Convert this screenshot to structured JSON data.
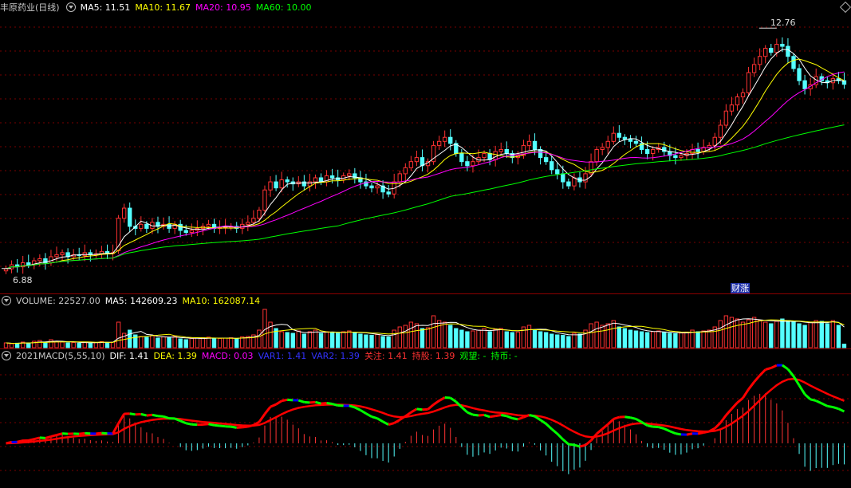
{
  "colors": {
    "bg": "#000000",
    "up": "#ff3232",
    "down": "#54ffff",
    "grid": "#7a0000",
    "sep": "#8b0000",
    "ma5": "#ffffff",
    "ma10": "#ffff00",
    "ma20": "#ff00ff",
    "ma60": "#00ff00",
    "vma5": "#ffffff",
    "vma10": "#ffff00",
    "dif_up": "#ff0000",
    "dif_down": "#00ff00",
    "dif_flat": "#0000ff",
    "dea": "#ff0000",
    "macd_pos": "#ff3232",
    "macd_neg": "#54ffff",
    "var1": "#3333ff",
    "var2": "#3333ff",
    "guanzhu": "#ff3232",
    "chigu": "#ff3232",
    "guanwang": "#00ff00",
    "chibi": "#00ff00"
  },
  "price_panel": {
    "title": "丰原药业(日线)",
    "ma5": "MA5: 11.51",
    "ma10": "MA10: 11.67",
    "ma20": "MA20: 10.95",
    "ma60": "MA60: 10.00",
    "high_label": "12.76",
    "low_label": "6.88",
    "event_label": "财涨"
  },
  "volume_panel": {
    "title": "VOLUME: 22527.00",
    "ma5": "MA5: 142609.23",
    "ma10": "MA10: 162087.14"
  },
  "macd_panel": {
    "title": "2021MACD(5,55,10)",
    "dif": "DIF: 1.41",
    "dea": "DEA: 1.39",
    "macd": "MACD: 0.03",
    "var1": "VAR1: 1.41",
    "var2": "VAR2: 1.39",
    "guanzhu": "关注: 1.41",
    "chigu": "持股: 1.39",
    "guanwang": "观望: -",
    "chibi": "持币: -"
  },
  "chart_data": {
    "type": "candlestick",
    "count": 150,
    "price_range": [
      6.5,
      13.2
    ],
    "high": 12.76,
    "low": 6.88,
    "candles_count_note": "",
    "closes": [
      6.95,
      7.05,
      7.0,
      7.1,
      7.05,
      7.15,
      7.2,
      7.1,
      7.25,
      7.3,
      7.35,
      7.25,
      7.3,
      7.28,
      7.35,
      7.3,
      7.32,
      7.38,
      7.33,
      7.35,
      8.2,
      8.45,
      8.0,
      7.95,
      8.05,
      7.95,
      8.1,
      8.0,
      8.05,
      7.95,
      8.05,
      7.9,
      7.85,
      7.9,
      7.95,
      8.0,
      8.05,
      7.95,
      7.98,
      7.98,
      8.0,
      7.95,
      8.05,
      8.1,
      8.2,
      8.4,
      8.9,
      9.1,
      8.95,
      9.15,
      9.1,
      9.05,
      9.1,
      9.0,
      9.1,
      9.2,
      9.1,
      9.25,
      9.2,
      9.15,
      9.25,
      9.3,
      9.2,
      9.1,
      9.0,
      8.95,
      9.0,
      8.85,
      8.8,
      9.1,
      9.3,
      9.45,
      9.6,
      9.7,
      9.5,
      9.6,
      10.0,
      10.1,
      10.2,
      10.05,
      9.8,
      9.6,
      9.5,
      9.6,
      9.7,
      9.8,
      9.65,
      9.85,
      9.9,
      9.8,
      9.7,
      9.75,
      10.0,
      10.1,
      9.9,
      9.7,
      9.6,
      9.4,
      9.3,
      9.1,
      9.0,
      9.2,
      9.1,
      9.3,
      9.6,
      9.9,
      9.95,
      10.1,
      10.3,
      10.2,
      10.15,
      10.1,
      10.05,
      9.9,
      9.8,
      9.9,
      9.95,
      9.85,
      9.75,
      9.7,
      9.75,
      9.8,
      9.9,
      9.85,
      9.95,
      10.0,
      10.2,
      10.5,
      10.85,
      11.0,
      11.2,
      11.3,
      11.8,
      12.0,
      12.2,
      12.4,
      12.3,
      12.5,
      12.45,
      12.2,
      11.9,
      11.6,
      11.4,
      11.5,
      11.7,
      11.6,
      11.55,
      11.65,
      11.6,
      11.51
    ],
    "opens": [
      6.9,
      6.95,
      7.05,
      7.0,
      7.1,
      7.05,
      7.15,
      7.2,
      7.1,
      7.25,
      7.3,
      7.35,
      7.25,
      7.3,
      7.28,
      7.35,
      7.3,
      7.32,
      7.38,
      7.33,
      7.4,
      8.2,
      8.45,
      8.0,
      7.95,
      8.05,
      7.95,
      8.1,
      8.0,
      8.05,
      7.95,
      8.05,
      7.9,
      7.85,
      7.9,
      7.95,
      8.0,
      8.05,
      7.95,
      7.98,
      7.98,
      8.0,
      7.95,
      8.05,
      8.1,
      8.2,
      8.4,
      8.9,
      9.1,
      8.95,
      9.15,
      9.1,
      9.05,
      9.1,
      9.0,
      9.1,
      9.2,
      9.1,
      9.25,
      9.2,
      9.15,
      9.25,
      9.3,
      9.2,
      9.1,
      9.0,
      8.95,
      9.0,
      8.85,
      8.8,
      9.1,
      9.3,
      9.45,
      9.6,
      9.7,
      9.5,
      9.6,
      10.0,
      10.1,
      10.2,
      10.05,
      9.8,
      9.6,
      9.5,
      9.6,
      9.7,
      9.8,
      9.65,
      9.85,
      9.9,
      9.8,
      9.7,
      9.75,
      10.0,
      10.1,
      9.9,
      9.7,
      9.6,
      9.4,
      9.3,
      9.1,
      9.0,
      9.2,
      9.1,
      9.3,
      9.6,
      9.9,
      9.95,
      10.1,
      10.3,
      10.2,
      10.15,
      10.1,
      10.05,
      9.9,
      9.8,
      9.9,
      9.95,
      9.85,
      9.75,
      9.7,
      9.75,
      9.8,
      9.9,
      9.85,
      9.95,
      10.0,
      10.2,
      10.5,
      10.85,
      11.0,
      11.2,
      11.3,
      11.8,
      12.0,
      12.2,
      12.4,
      12.3,
      12.5,
      12.45,
      12.2,
      11.9,
      11.6,
      11.4,
      11.5,
      11.7,
      11.6,
      11.55,
      11.65,
      11.6
    ],
    "volumes": [
      30,
      25,
      28,
      35,
      30,
      40,
      45,
      30,
      50,
      40,
      35,
      30,
      32,
      28,
      35,
      30,
      32,
      38,
      33,
      35,
      160,
      90,
      110,
      80,
      70,
      65,
      75,
      60,
      68,
      62,
      70,
      55,
      50,
      58,
      60,
      62,
      66,
      55,
      58,
      60,
      62,
      55,
      68,
      70,
      80,
      110,
      240,
      160,
      120,
      100,
      95,
      90,
      105,
      85,
      100,
      110,
      90,
      100,
      95,
      90,
      100,
      105,
      95,
      85,
      80,
      78,
      82,
      70,
      68,
      110,
      130,
      140,
      160,
      150,
      120,
      125,
      200,
      170,
      160,
      140,
      120,
      110,
      100,
      105,
      110,
      120,
      100,
      115,
      120,
      100,
      95,
      98,
      130,
      140,
      110,
      100,
      95,
      85,
      80,
      78,
      70,
      90,
      85,
      110,
      150,
      160,
      140,
      150,
      170,
      130,
      120,
      110,
      105,
      100,
      95,
      100,
      105,
      95,
      90,
      88,
      92,
      98,
      110,
      100,
      105,
      110,
      130,
      170,
      200,
      190,
      180,
      160,
      175,
      190,
      170,
      160,
      150,
      165,
      180,
      170,
      160,
      150,
      140,
      160,
      170,
      165,
      150,
      170,
      140,
      22
    ],
    "ma_lines": [
      "MA5",
      "MA10",
      "MA20",
      "MA60"
    ],
    "series": [
      {
        "name": "DIF"
      },
      {
        "name": "DEA"
      },
      {
        "name": "MACD"
      }
    ]
  }
}
